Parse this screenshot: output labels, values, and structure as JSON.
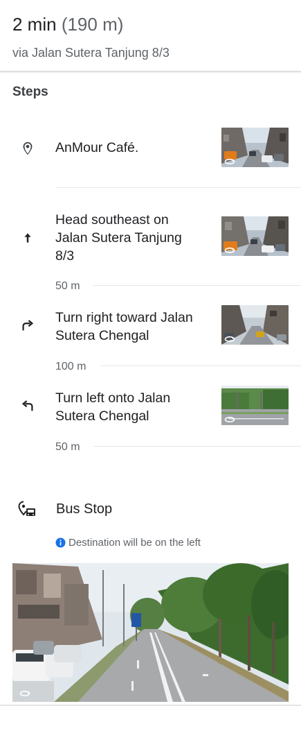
{
  "header": {
    "duration": "2 min",
    "distance": "(190 m)",
    "via": "via Jalan Sutera Tanjung 8/3"
  },
  "steps_title": "Steps",
  "steps": [
    {
      "icon": "place-icon",
      "text": "AnMour Café.",
      "distance": ""
    },
    {
      "icon": "arrow-up-icon",
      "text_lines": [
        "Head southeast on",
        "Jalan Sutera Tanjung",
        "8/3"
      ],
      "distance": "50 m"
    },
    {
      "icon": "turn-right-icon",
      "text_lines": [
        "Turn right toward Jalan",
        "Sutera Chengal"
      ],
      "distance": "100 m"
    },
    {
      "icon": "turn-left-icon",
      "text_lines": [
        "Turn left onto Jalan",
        "Sutera Chengal"
      ],
      "distance": "50 m"
    }
  ],
  "destination": {
    "icon": "bus-stop-pin-icon",
    "label": "Bus Stop",
    "info_icon": "info-icon",
    "info_text": "Destination will be on the left"
  },
  "colors": {
    "primary_text": "#202124",
    "secondary_text": "#5f6368",
    "info_blue": "#1a73e8"
  }
}
